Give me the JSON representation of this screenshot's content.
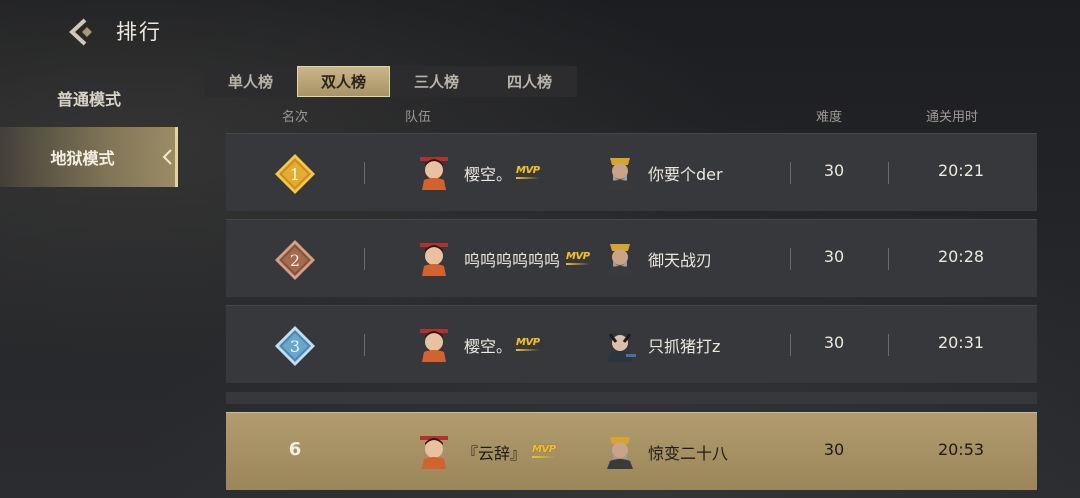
{
  "header": {
    "title": "排行"
  },
  "sidebar": {
    "items": [
      {
        "label": "普通模式"
      },
      {
        "label": "地狱模式"
      }
    ]
  },
  "tabs": [
    {
      "label": "单人榜"
    },
    {
      "label": "双人榜"
    },
    {
      "label": "三人榜"
    },
    {
      "label": "四人榜"
    }
  ],
  "columns": {
    "rank": "名次",
    "team": "队伍",
    "difficulty": "难度",
    "time": "通关用时"
  },
  "rows": [
    {
      "rank": "1",
      "p1": "樱空。",
      "p1_mvp": "MVP",
      "p2": "你要个der",
      "difficulty": "30",
      "time": "20:21"
    },
    {
      "rank": "2",
      "p1": "呜呜呜呜呜呜",
      "p1_mvp": "MVP",
      "p2": "御天战刃",
      "difficulty": "30",
      "time": "20:28"
    },
    {
      "rank": "3",
      "p1": "樱空。",
      "p1_mvp": "MVP",
      "p2": "只抓猪打z",
      "difficulty": "30",
      "time": "20:31"
    }
  ],
  "self_row": {
    "rank": "6",
    "p1": "『云辞』",
    "p1_mvp": "MVP",
    "p2": "惊变二十八",
    "difficulty": "30",
    "time": "20:53"
  },
  "colors": {
    "gold": "#d7a42a",
    "bronze": "#a0674a",
    "silver": "#5b94b8",
    "accent": "#b19c6f"
  }
}
